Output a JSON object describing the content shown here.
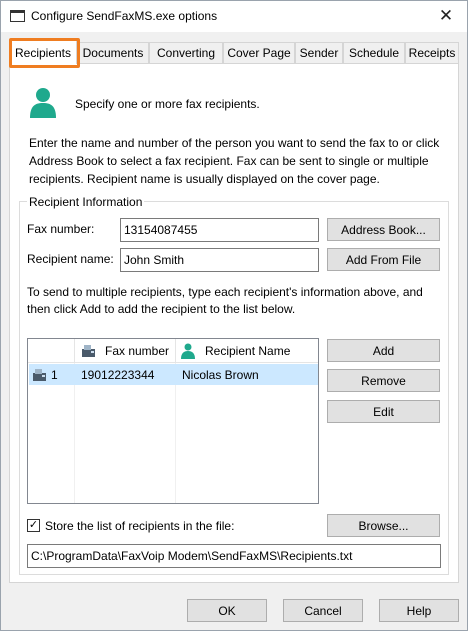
{
  "window": {
    "title": "Configure SendFaxMS.exe options",
    "close_glyph": "✕"
  },
  "tabs": [
    {
      "label": "Recipients",
      "active": true
    },
    {
      "label": "Documents"
    },
    {
      "label": "Converting"
    },
    {
      "label": "Cover Page"
    },
    {
      "label": "Sender"
    },
    {
      "label": "Schedule"
    },
    {
      "label": "Receipts"
    }
  ],
  "intro": {
    "icon": "user-icon",
    "text": "Specify one or more fax recipients."
  },
  "description": "Enter the name and number of the person you want to send the fax to or click Address Book to select a fax recipient. Fax can be sent to single or multiple recipients. Recipient name is usually displayed on the cover page.",
  "recipient_info": {
    "group_label": "Recipient Information",
    "fax_label": "Fax number:",
    "fax_value": "13154087455",
    "name_label": "Recipient name:",
    "name_value": "John Smith",
    "address_book_button": "Address Book...",
    "add_from_file_button": "Add From File",
    "help_text": "To send to multiple recipients, type each recipient's information above, and then click Add to add the recipient to the list below."
  },
  "list": {
    "columns": [
      {
        "label": ""
      },
      {
        "label": "Fax number",
        "icon": "fax-icon"
      },
      {
        "label": "Recipient Name",
        "icon": "user-icon"
      }
    ],
    "rows": [
      {
        "index": "1",
        "fax": "19012223344",
        "name": "Nicolas Brown",
        "selected": true
      }
    ]
  },
  "list_buttons": {
    "add": "Add",
    "remove": "Remove",
    "edit": "Edit"
  },
  "store": {
    "checkbox_label": "Store the list of recipients in the file:",
    "checked": true,
    "check_glyph": "✓",
    "browse_button": "Browse...",
    "path_value": "C:\\ProgramData\\FaxVoip Modem\\SendFaxMS\\Recipients.txt"
  },
  "footer": {
    "ok": "OK",
    "cancel": "Cancel",
    "help": "Help"
  },
  "colors": {
    "accent_orange": "#ef7d21",
    "user_icon_teal": "#1fa98d",
    "selection": "#cce8ff"
  }
}
